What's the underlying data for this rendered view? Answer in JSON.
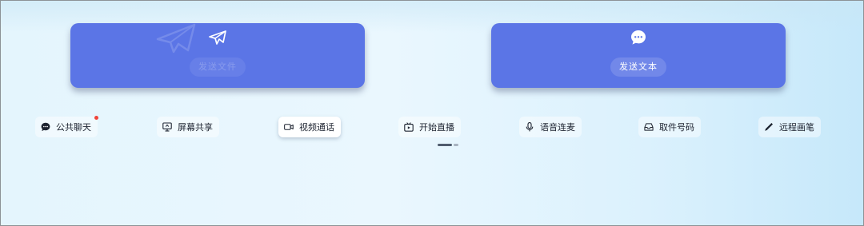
{
  "cards": {
    "send_file": {
      "label": "发送文件",
      "icon": "paper-plane-icon",
      "enabled": false
    },
    "send_text": {
      "label": "发送文本",
      "icon": "chat-bubble-icon",
      "enabled": true
    }
  },
  "toolbar": {
    "items": [
      {
        "label": "公共聊天",
        "icon": "chat-bubble-icon",
        "badge": true
      },
      {
        "label": "屏幕共享",
        "icon": "monitor-share-icon"
      },
      {
        "label": "视频通话",
        "icon": "video-camera-icon",
        "active": true
      },
      {
        "label": "开始直播",
        "icon": "live-tv-icon"
      },
      {
        "label": "语音连麦",
        "icon": "microphone-icon"
      },
      {
        "label": "取件号码",
        "icon": "inbox-tray-icon"
      },
      {
        "label": "远程画笔",
        "icon": "pen-icon"
      }
    ]
  },
  "pager": {
    "current_page": 1,
    "total_pages": 2
  },
  "colors": {
    "card": "#5b75e6",
    "badge": "#f0443a",
    "background": "#e4f5fd"
  }
}
